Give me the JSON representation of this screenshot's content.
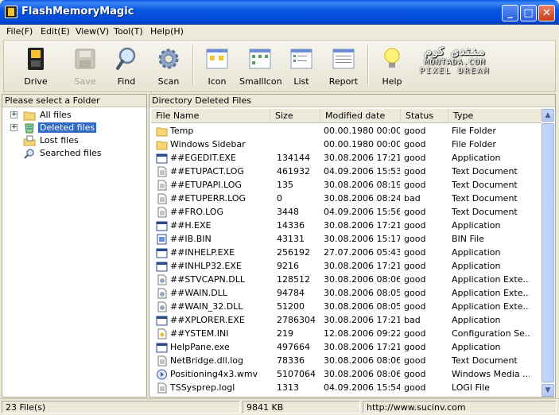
{
  "window": {
    "title": "FlashMemoryMagic",
    "min": "_",
    "max": "□",
    "close": "✕"
  },
  "menu": [
    "File(F)",
    "Edit(E)",
    "View(V)",
    "Tool(T)",
    "Help(H)"
  ],
  "toolbar": {
    "drive": "Drive",
    "save": "Save",
    "find": "Find",
    "scan": "Scan",
    "icon": "Icon",
    "smallicon": "SmallIcon",
    "list": "List",
    "report": "Report",
    "help": "Help"
  },
  "brand": {
    "line1": "منتدى كوم",
    "line2": "MONTADA.COM",
    "line3": "PIXEL DREAM"
  },
  "left": {
    "header": "Please select a Folder",
    "tree": [
      {
        "label": "All files",
        "expandable": true,
        "selected": false,
        "icon": "folder-icon"
      },
      {
        "label": "Deleted files",
        "expandable": true,
        "selected": true,
        "icon": "recycle-icon"
      },
      {
        "label": "Lost files",
        "expandable": false,
        "selected": false,
        "icon": "lost-files-icon"
      },
      {
        "label": "Searched files",
        "expandable": false,
        "selected": false,
        "icon": "search-files-icon"
      }
    ]
  },
  "right": {
    "directory_label": "Directory",
    "directory_value": "Deleted Files",
    "columns": [
      "File Name",
      "Size",
      "Modified date",
      "Status",
      "Type"
    ],
    "files": [
      {
        "name": "Temp",
        "size": "",
        "date": "00.00.1980 00:00",
        "status": "good",
        "type": "File Folder",
        "icon": "folder"
      },
      {
        "name": "Windows Sidebar",
        "size": "",
        "date": "00.00.1980 00:00",
        "status": "good",
        "type": "File Folder",
        "icon": "folder"
      },
      {
        "name": "##EGEDIT.EXE",
        "size": "134144",
        "date": "30.08.2006 17:21",
        "status": "good",
        "type": "Application",
        "icon": "app"
      },
      {
        "name": "##ETUPACT.LOG",
        "size": "461932",
        "date": "04.09.2006 15:53",
        "status": "good",
        "type": "Text Document",
        "icon": "doc"
      },
      {
        "name": "##ETUPAPI.LOG",
        "size": "135",
        "date": "30.08.2006 08:19",
        "status": "good",
        "type": "Text Document",
        "icon": "doc"
      },
      {
        "name": "##ETUPERR.LOG",
        "size": "0",
        "date": "30.08.2006 08:24",
        "status": "bad",
        "type": "Text Document",
        "icon": "doc"
      },
      {
        "name": "##FRO.LOG",
        "size": "3448",
        "date": "04.09.2006 15:56",
        "status": "good",
        "type": "Text Document",
        "icon": "doc"
      },
      {
        "name": "##H.EXE",
        "size": "14336",
        "date": "30.08.2006 17:21",
        "status": "good",
        "type": "Application",
        "icon": "app"
      },
      {
        "name": "##IB.BIN",
        "size": "43131",
        "date": "30.08.2006 15:17",
        "status": "good",
        "type": "BIN File",
        "icon": "bin"
      },
      {
        "name": "##INHELP.EXE",
        "size": "256192",
        "date": "27.07.2006 05:43",
        "status": "good",
        "type": "Application",
        "icon": "app"
      },
      {
        "name": "##INHLP32.EXE",
        "size": "9216",
        "date": "30.08.2006 17:21",
        "status": "good",
        "type": "Application",
        "icon": "app"
      },
      {
        "name": "##STVCAPN.DLL",
        "size": "128512",
        "date": "30.08.2006 08:06",
        "status": "good",
        "type": "Application Exte...",
        "icon": "dll"
      },
      {
        "name": "##WAIN.DLL",
        "size": "94784",
        "date": "30.08.2006 08:05",
        "status": "good",
        "type": "Application Exte...",
        "icon": "dll"
      },
      {
        "name": "##WAIN_32.DLL",
        "size": "51200",
        "date": "30.08.2006 08:05",
        "status": "good",
        "type": "Application Exte...",
        "icon": "dll"
      },
      {
        "name": "##XPLORER.EXE",
        "size": "2786304",
        "date": "30.08.2006 17:21",
        "status": "bad",
        "type": "Application",
        "icon": "app"
      },
      {
        "name": "##YSTEM.INI",
        "size": "219",
        "date": "12.08.2006 09:22",
        "status": "good",
        "type": "Configuration Se...",
        "icon": "ini"
      },
      {
        "name": "HelpPane.exe",
        "size": "497664",
        "date": "30.08.2006 17:21",
        "status": "good",
        "type": "Application",
        "icon": "app"
      },
      {
        "name": "NetBridge.dll.log",
        "size": "78336",
        "date": "30.08.2006 08:06",
        "status": "good",
        "type": "Text Document",
        "icon": "doc"
      },
      {
        "name": "Positioning4x3.wmv",
        "size": "5107064",
        "date": "30.08.2006 08:06",
        "status": "good",
        "type": "Windows Media ...",
        "icon": "media"
      },
      {
        "name": "TSSysprep.logl",
        "size": "1313",
        "date": "04.09.2006 15:54",
        "status": "good",
        "type": "LOGl File",
        "icon": "doc"
      }
    ]
  },
  "status": {
    "count": "23 File(s)",
    "size": "9841 KB",
    "url": "http://www.sucinv.com"
  }
}
